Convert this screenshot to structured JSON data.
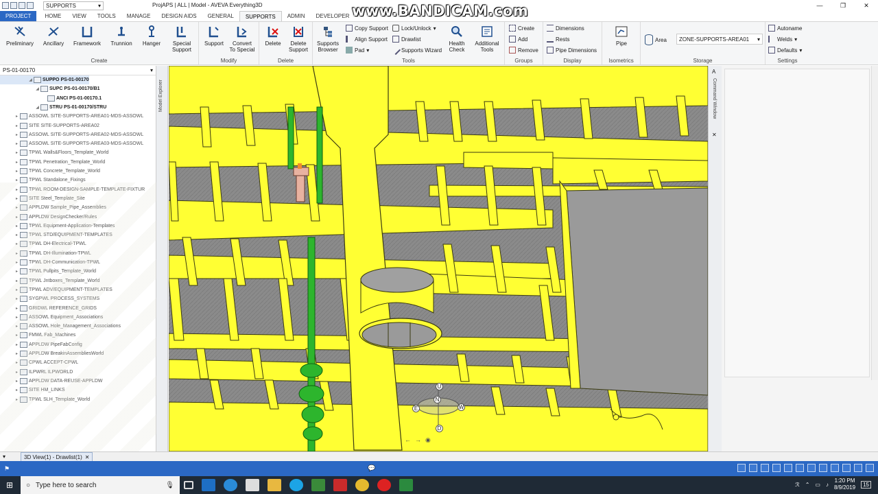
{
  "window": {
    "title": "ProjAPS | ALL | Model - AVEVA Everything3D",
    "context_combo": "SUPPORTS",
    "watermark": "www.BANDICAM.com"
  },
  "ribbon_tabs": [
    "PROJECT",
    "HOME",
    "VIEW",
    "TOOLS",
    "MANAGE",
    "DESIGN AIDS",
    "GENERAL",
    "SUPPORTS",
    "ADMIN",
    "DEVELOPER"
  ],
  "active_tab": "SUPPORTS",
  "ribbon": {
    "create": {
      "label": "Create",
      "buttons": [
        "Preliminary",
        "Ancillary",
        "Framework",
        "Trunnion",
        "Hanger",
        "Special\nSupport"
      ]
    },
    "modify": {
      "label": "Modify",
      "buttons": [
        "Support",
        "Convert\nTo Special"
      ]
    },
    "delete": {
      "label": "Delete",
      "buttons": [
        "Delete",
        "Delete\nSupport"
      ]
    },
    "tools": {
      "label": "Tools",
      "big_buttons": [
        "Supports\nBrowser",
        "Health\nCheck",
        "Additional\nTools"
      ],
      "small": [
        "Copy Support",
        "Align Support",
        "Pad",
        "Lock/Unlock",
        "Drawlist",
        "Supports Wizard"
      ]
    },
    "groups": {
      "label": "Groups",
      "small": [
        "Create",
        "Add",
        "Remove"
      ]
    },
    "display": {
      "label": "Display",
      "small": [
        "Dimensions",
        "Rests",
        "Pipe Dimensions"
      ]
    },
    "isometrics": {
      "label": "Isometrics",
      "buttons": [
        "Pipe"
      ]
    },
    "storage": {
      "label": "Storage",
      "area_label": "Area",
      "area_value": "ZONE-SUPPORTS-AREA01"
    },
    "settings": {
      "label": "Settings",
      "small": [
        "Autoname",
        "Welds",
        "Defaults"
      ]
    }
  },
  "explorer": {
    "header": "PS-01-00170",
    "side_label": "Model Explorer",
    "tree": [
      {
        "label": "SUPPO PS-01-00170",
        "level": 3,
        "bold": true,
        "selected": true
      },
      {
        "label": "SUPC PS-01-00170/B1",
        "level": 4,
        "bold": true
      },
      {
        "label": "ANCI PS-01-00170.1",
        "level": 5,
        "bold": true
      },
      {
        "label": "STRU PS-01-00170/STRU",
        "level": 4,
        "bold": true
      },
      {
        "label": "ASSOWL SITE-SUPPORTS-AREA01-MDS-ASSOWL",
        "level": 1
      },
      {
        "label": "SITE SITE-SUPPORTS-AREA02",
        "level": 1
      },
      {
        "label": "ASSOWL SITE-SUPPORTS-AREA02-MDS-ASSOWL",
        "level": 1
      },
      {
        "label": "ASSOWL SITE-SUPPORTS-AREA03-MDS-ASSOWL",
        "level": 1
      },
      {
        "label": "TPWL Walls&Floors_Template_World",
        "level": 1
      },
      {
        "label": "TPWL Penetration_Template_World",
        "level": 1
      },
      {
        "label": "TPWL Concrete_Template_World",
        "level": 1
      },
      {
        "label": "TPWL Standalone_Fixings",
        "level": 1
      },
      {
        "label": "TPWL ROOM-DESIGN-SAMPLE-TEMPLATE-FIXTUR",
        "level": 1
      },
      {
        "label": "SITE Steel_Template_Site",
        "level": 1
      },
      {
        "label": "APPLDW Sample_Pipe_Assemblies",
        "level": 1
      },
      {
        "label": "APPLDW DesignChecker/Rules",
        "level": 1
      },
      {
        "label": "TPWL Equipment-Application-Templates",
        "level": 1
      },
      {
        "label": "TPWL STD/EQUIPMENT-TEMPLATES",
        "level": 1
      },
      {
        "label": "TPWL DH-Electrical-TPWL",
        "level": 1
      },
      {
        "label": "TPWL DH-Illumination-TPWL",
        "level": 1
      },
      {
        "label": "TPWL DH-Communication-TPWL",
        "level": 1
      },
      {
        "label": "TPWL Pullpits_Template_World",
        "level": 1
      },
      {
        "label": "TPWL Jntboxes_Template_World",
        "level": 1
      },
      {
        "label": "TPWL ADV/EQUIPMENT-TEMPLATES",
        "level": 1
      },
      {
        "label": "SYGPWL PROCESS_SYSTEMS",
        "level": 1
      },
      {
        "label": "GRIDWL REFERENCE_GRIDS",
        "level": 1
      },
      {
        "label": "ASSOWL Equipment_Associations",
        "level": 1
      },
      {
        "label": "ASSOWL Hole_Management_Associations",
        "level": 1
      },
      {
        "label": "FMWL Fab_Machines",
        "level": 1
      },
      {
        "label": "APPLDW PipeFabConfig",
        "level": 1
      },
      {
        "label": "APPLDW BreakinAssembliesWorld",
        "level": 1
      },
      {
        "label": "CPWL ACCEPT-CPWL",
        "level": 1
      },
      {
        "label": "ILPWRL ILPWORLD",
        "level": 1
      },
      {
        "label": "APPLDW DATA-REUSE-APPLDW",
        "level": 1
      },
      {
        "label": "SITE HM_LINKS",
        "level": 1
      },
      {
        "label": "TPWL SLH_Template_World",
        "level": 1
      }
    ]
  },
  "command_window": {
    "label": "Command Window"
  },
  "viewport": {
    "compass": [
      "U",
      "N",
      "E",
      "W",
      "D"
    ]
  },
  "doc_tab": {
    "label": "3D View(1) - Drawlist(1)"
  },
  "taskbar": {
    "search_placeholder": "Type here to search",
    "time": "1:20 PM",
    "date": "8/9/2019",
    "notification_count": "15"
  },
  "colors": {
    "structure_yellow": "#ffff33",
    "structure_edge": "#3a3a10",
    "pipe_green": "#2db52d",
    "ribbon_blue": "#2b68c4",
    "floor_grey": "#8b8b8b"
  }
}
